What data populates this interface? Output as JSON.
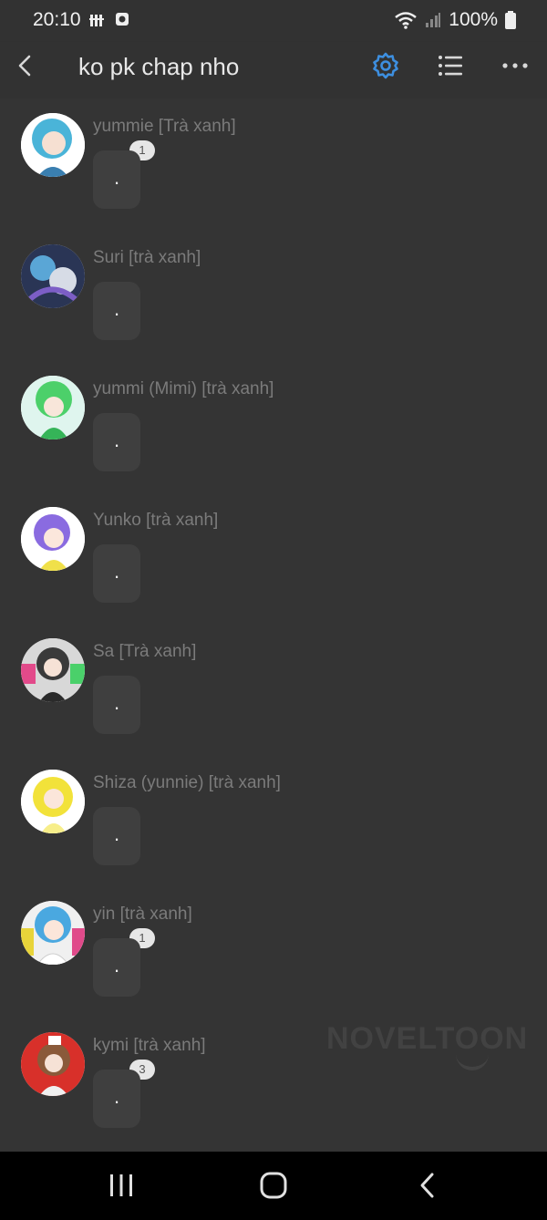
{
  "status": {
    "time": "20:10",
    "battery": "100%"
  },
  "header": {
    "title": "ko pk chap nho",
    "accent": "#3d8fe0"
  },
  "messages": [
    {
      "author": "yummie [Trà xanh]",
      "text": ".",
      "badge": "1",
      "avatar_color": "#4ab4d8"
    },
    {
      "author": "Suri [trà xanh]",
      "text": ".",
      "badge": "",
      "avatar_color": "#2a3555"
    },
    {
      "author": "yummi (Mimi) [trà xanh]",
      "text": ".",
      "badge": "",
      "avatar_color": "#4cd06a"
    },
    {
      "author": "Yunko [trà xanh]",
      "text": ".",
      "badge": "",
      "avatar_color": "#8a6be0"
    },
    {
      "author": "Sa [Trà xanh]",
      "text": ".",
      "badge": "",
      "avatar_color": "#3a3a3a"
    },
    {
      "author": "Shiza (yunnie) [trà xanh]",
      "text": ".",
      "badge": "",
      "avatar_color": "#f2e23a"
    },
    {
      "author": "yin [trà xanh]",
      "text": ".",
      "badge": "1",
      "avatar_color": "#4aa8e0"
    },
    {
      "author": "kymi [trà xanh]",
      "text": ".",
      "badge": "3",
      "avatar_color": "#d8302a"
    }
  ],
  "watermark": "NOVELTOON"
}
